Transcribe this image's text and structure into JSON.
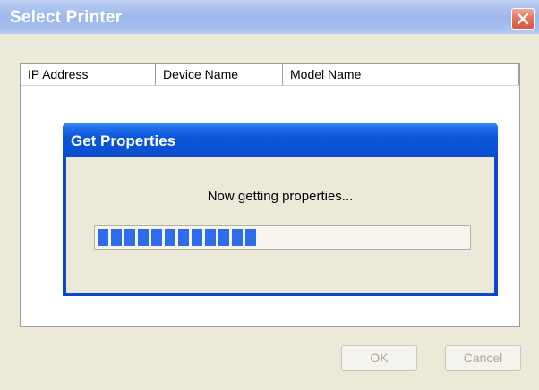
{
  "window": {
    "title": "Select Printer"
  },
  "list": {
    "columns": [
      "IP Address",
      "Device Name",
      "Model Name"
    ]
  },
  "progress_dialog": {
    "title": "Get Properties",
    "message": "Now getting properties...",
    "progress_fraction": 0.45
  },
  "buttons": {
    "ok_label": "OK",
    "cancel_label": "Cancel"
  },
  "icons": {
    "close": "close-icon"
  },
  "colors": {
    "progress_fill": "#2F6CEB",
    "close_button": "#D55A40",
    "dialog_title_bar": "#0A56D9"
  }
}
